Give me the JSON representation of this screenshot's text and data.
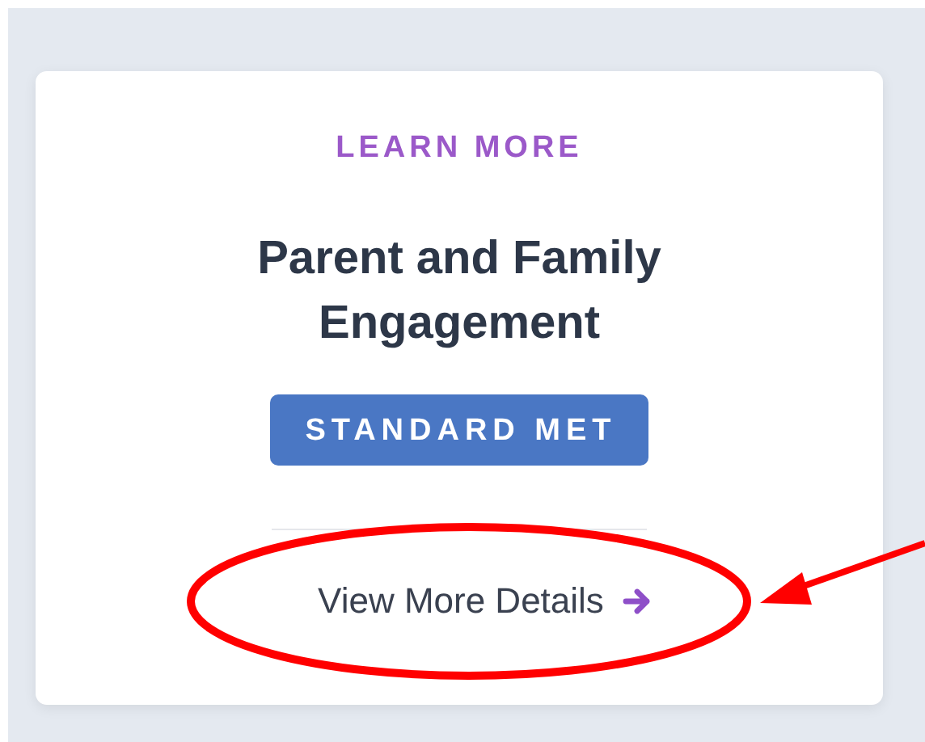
{
  "card": {
    "eyebrow": "LEARN MORE",
    "title": "Parent and Family Engagement",
    "status": {
      "label": "STANDARD MET",
      "kind": "met"
    },
    "link": {
      "label": "View More Details"
    }
  },
  "highlight": {
    "kind": "circled_with_arrow"
  }
}
